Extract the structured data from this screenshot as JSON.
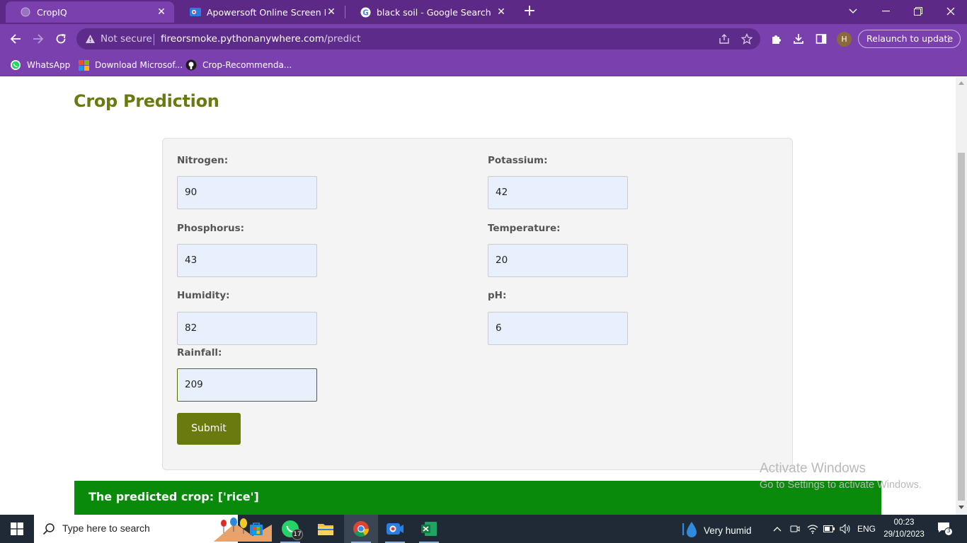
{
  "browser": {
    "tabs": [
      {
        "title": "CropIQ",
        "active": true
      },
      {
        "title": "Apowersoft Online Screen Recor",
        "active": false
      },
      {
        "title": "black soil - Google Search",
        "active": false
      }
    ],
    "address": {
      "security_label": "Not secure",
      "host": "fireorsmoke.pythonanywhere.com",
      "path": "/predict"
    },
    "profile_initial": "H",
    "relaunch_label": "Relaunch to update",
    "bookmarks": [
      {
        "label": "WhatsApp",
        "icon": "whatsapp-icon"
      },
      {
        "label": "Download Microsof...",
        "icon": "microsoft-icon"
      },
      {
        "label": "Crop-Recommenda...",
        "icon": "github-icon"
      }
    ]
  },
  "page": {
    "title": "Crop Prediction",
    "fields": {
      "nitrogen": {
        "label": "Nitrogen:",
        "value": "90"
      },
      "potassium": {
        "label": "Potassium:",
        "value": "42"
      },
      "phosphorus": {
        "label": "Phosphorus:",
        "value": "43"
      },
      "temperature": {
        "label": "Temperature:",
        "value": "20"
      },
      "humidity": {
        "label": "Humidity:",
        "value": "82"
      },
      "ph": {
        "label": "pH:",
        "value": "6"
      },
      "rainfall": {
        "label": "Rainfall:",
        "value": "209"
      }
    },
    "submit_label": "Submit",
    "result_text": "The predicted crop: ['rice']"
  },
  "watermark": {
    "line1": "Activate Windows",
    "line2": "Go to Settings to activate Windows."
  },
  "taskbar": {
    "search_placeholder": "Type here to search",
    "whatsapp_badge": "17",
    "weather": "Very humid",
    "language": "ENG",
    "time": "00:23",
    "date": "29/10/2023",
    "notifications": "3"
  },
  "colors": {
    "chrome_dark": "#5c2a86",
    "chrome": "#7a40ae",
    "accent_olive": "#6b7a0e",
    "result_green": "#0a8a0a",
    "input_bg": "#e8f0fe"
  }
}
